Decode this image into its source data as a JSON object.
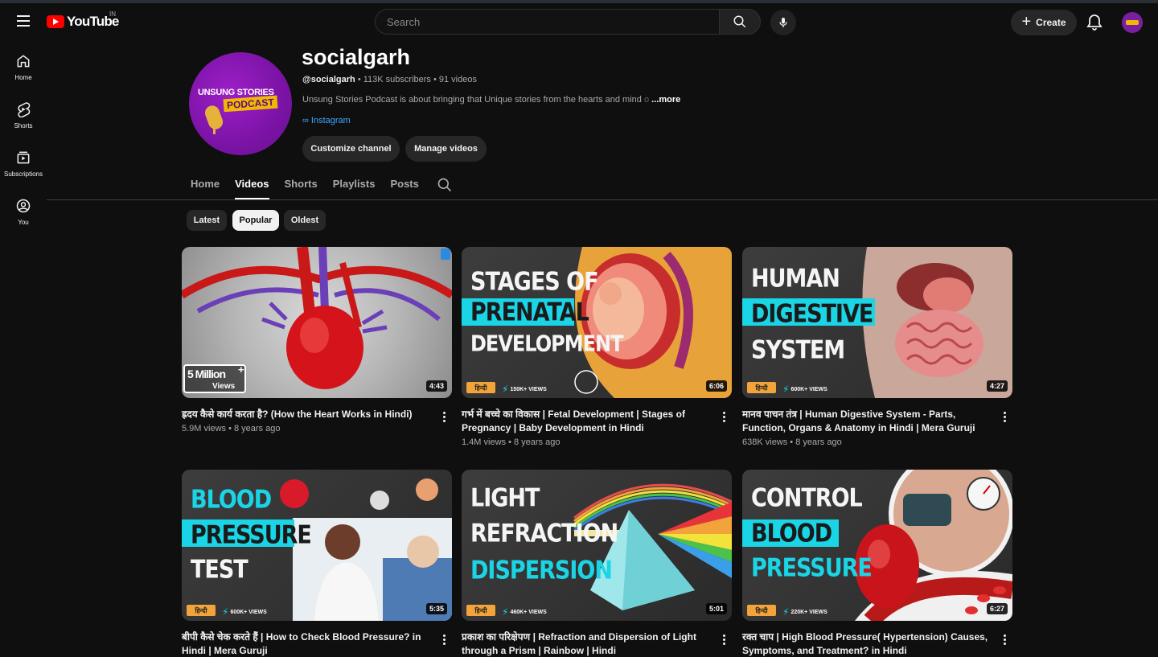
{
  "masthead": {
    "logo_text": "YouTube",
    "country": "IN",
    "search_placeholder": "Search",
    "create_label": "Create"
  },
  "sidenav": {
    "items": [
      {
        "label": "Home",
        "icon": "home-icon"
      },
      {
        "label": "Shorts",
        "icon": "shorts-icon"
      },
      {
        "label": "Subscriptions",
        "icon": "subscriptions-icon"
      },
      {
        "label": "You",
        "icon": "you-icon"
      }
    ]
  },
  "channel": {
    "name": "socialgarh",
    "handle": "@socialgarh",
    "subscribers": "113K subscribers",
    "videos_count": "91 videos",
    "description": "Unsung Stories Podcast is about bringing that Unique stories from the hearts and mind",
    "description_fade": " o",
    "more_label": "...more",
    "link_label": "Instagram",
    "avatar_line1": "UNSUNG STORIES",
    "avatar_line2": "PODCAST",
    "customize_label": "Customize channel",
    "manage_label": "Manage videos"
  },
  "tabs": [
    "Home",
    "Videos",
    "Shorts",
    "Playlists",
    "Posts"
  ],
  "active_tab": "Videos",
  "chips": [
    "Latest",
    "Popular",
    "Oldest"
  ],
  "active_chip": "Popular",
  "videos": [
    {
      "title": "ह्रदय कैसे कार्य करता है? (How the Heart Works in Hindi)",
      "meta": "5.9M views • 8 years ago",
      "duration": "4:43",
      "badge_main": "5 Million",
      "badge_plus": "+",
      "badge_sub": "Views"
    },
    {
      "title": "गर्भ में बच्चे का विकास | Fetal Development | Stages of Pregnancy | Baby Development in Hindi",
      "meta": "1.4M views • 8 years ago",
      "duration": "6:06",
      "thumb_lines": [
        "STAGES OF",
        "PRENATAL",
        "DEVELOPMENT"
      ],
      "lang_tag": "हिन्दी",
      "views_tag": "150K",
      "views_plus": "+",
      "views_word": "VIEWS"
    },
    {
      "title": "मानव पाचन तंत्र | Human Digestive System - Parts, Function, Organs & Anatomy in Hindi | Mera Guruji",
      "meta": "638K views • 8 years ago",
      "duration": "4:27",
      "thumb_lines": [
        "HUMAN",
        "DIGESTIVE",
        "SYSTEM"
      ],
      "lang_tag": "हिन्दी",
      "views_tag": "600K",
      "views_plus": "+",
      "views_word": "VIEWS"
    },
    {
      "title": "बीपी कैसे चेक करते हैं | How to Check Blood Pressure? in Hindi | Mera Guruji",
      "meta": "",
      "duration": "5:35",
      "thumb_lines": [
        "BLOOD",
        "PRESSURE",
        "TEST"
      ],
      "lang_tag": "हिन्दी",
      "views_tag": "600K",
      "views_plus": "+",
      "views_word": "VIEWS"
    },
    {
      "title": "प्रकाश का परिक्षेपण | Refraction and Dispersion of Light through a Prism | Rainbow | Hindi",
      "meta": "",
      "duration": "5:01",
      "thumb_lines": [
        "LIGHT",
        "REFRACTION",
        "DISPERSION"
      ],
      "lang_tag": "हिन्दी",
      "views_tag": "460K",
      "views_plus": "+",
      "views_word": "VIEWS"
    },
    {
      "title": "रक्त चाप | High Blood Pressure( Hypertension) Causes, Symptoms, and Treatment? in Hindi",
      "meta": "",
      "duration": "6:27",
      "thumb_lines": [
        "CONTROL",
        "BLOOD",
        "PRESSURE"
      ],
      "lang_tag": "हिन्दी",
      "views_tag": "220K",
      "views_plus": "+",
      "views_word": "VIEWS"
    }
  ]
}
